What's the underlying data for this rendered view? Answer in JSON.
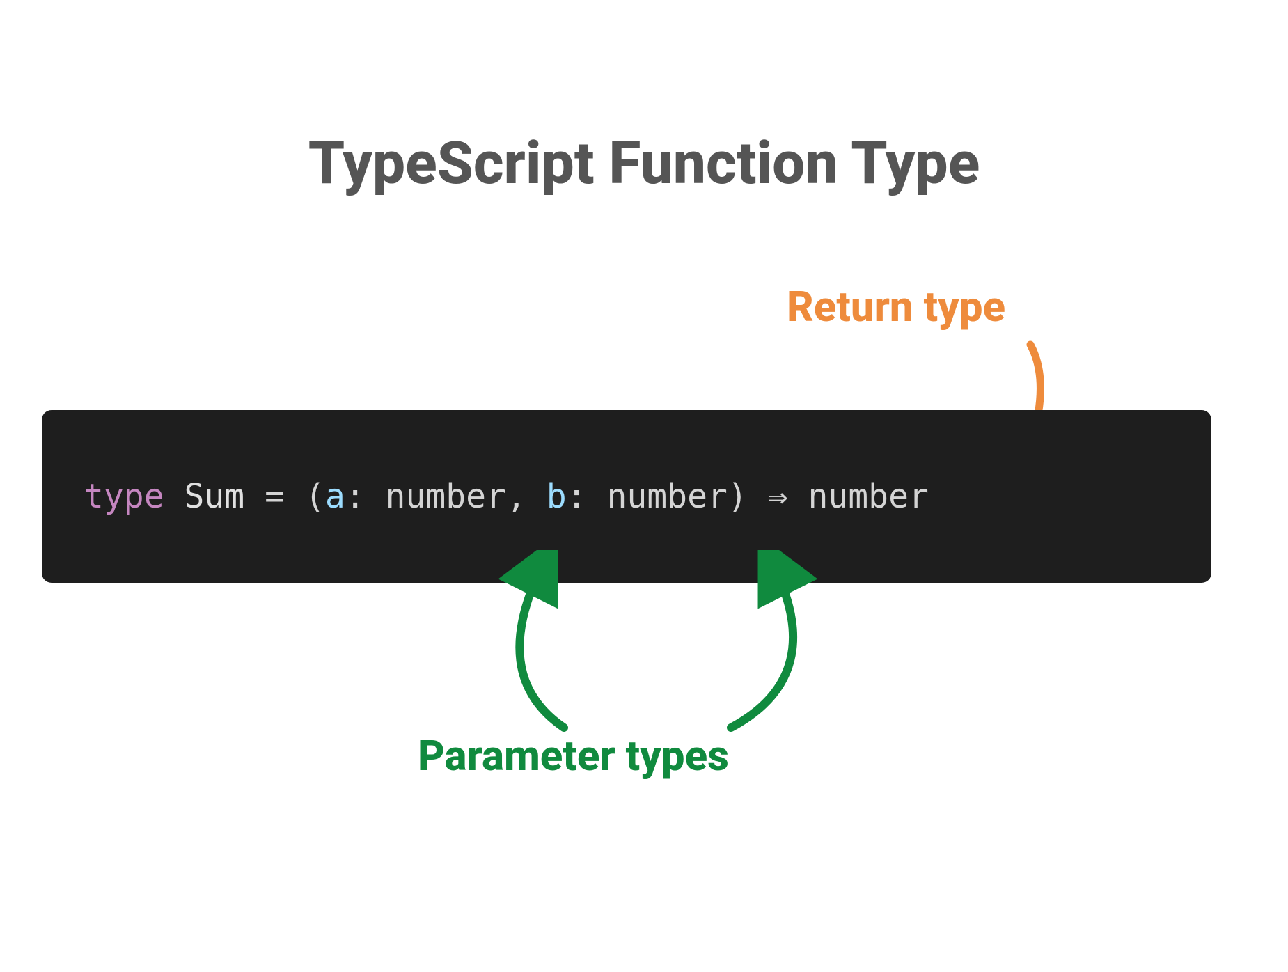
{
  "title": "TypeScript Function Type",
  "labels": {
    "return_type": "Return type",
    "parameter_types": "Parameter types"
  },
  "code": {
    "keyword": "type",
    "type_name": "Sum",
    "equals": "=",
    "open_paren": "(",
    "param1_name": "a",
    "param1_type": "number",
    "comma": ",",
    "param2_name": "b",
    "param2_type": "number",
    "close_paren": ")",
    "arrow": "⇒",
    "return_type": "number",
    "colon": ":"
  },
  "colors": {
    "title": "#555555",
    "return_label": "#EE8B3C",
    "param_label": "#108A3E",
    "code_bg": "#1e1e1e",
    "keyword": "#c586c0",
    "param": "#9cdcfe"
  }
}
